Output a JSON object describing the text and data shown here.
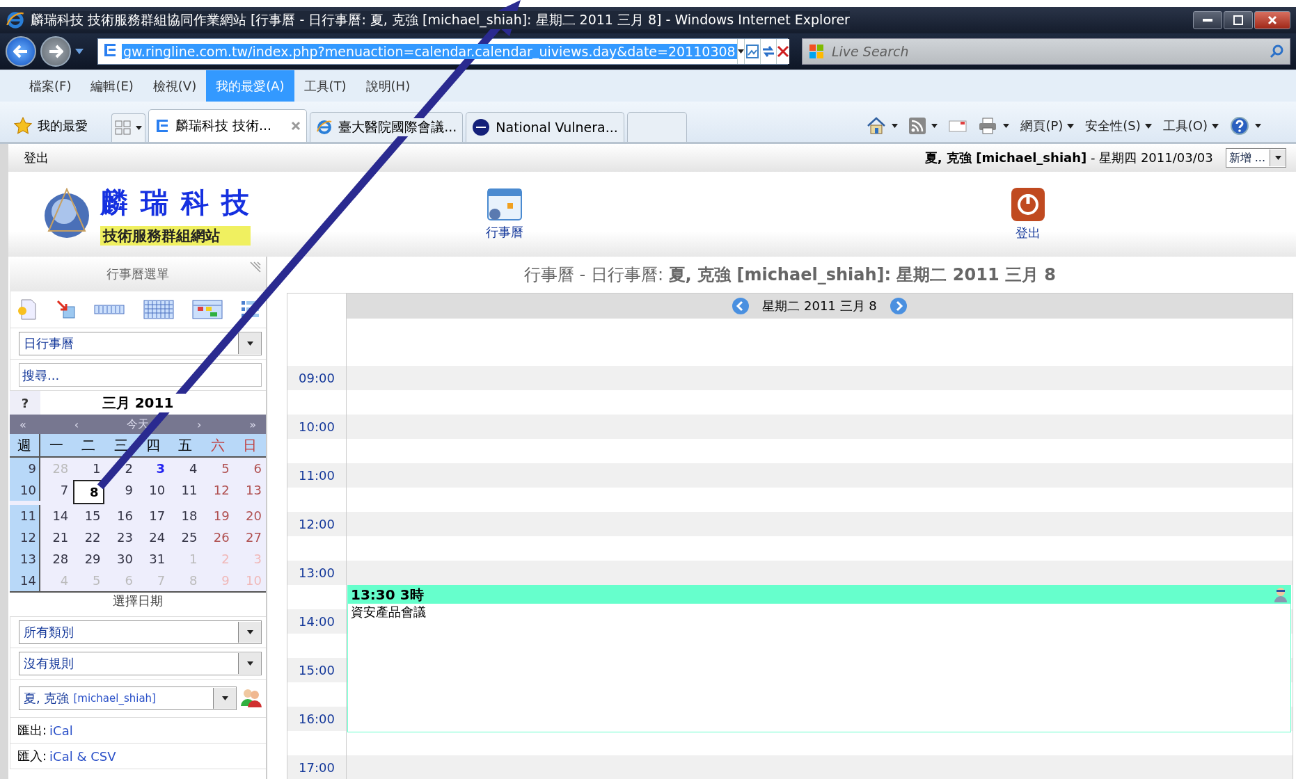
{
  "window": {
    "title": "麟瑞科技 技術服務群組協同作業網站 [行事曆 - 日行事曆: 夏, 克強 [michael_shiah]: 星期二 2011 三月 8] - Windows Internet Explorer"
  },
  "address_bar": {
    "url": "gw.ringline.com.tw/index.php?menuaction=calendar.calendar_uiviews.day&date=20110308"
  },
  "search": {
    "placeholder": "Live Search"
  },
  "menu": [
    {
      "label": "檔案(F)",
      "selected": false
    },
    {
      "label": "編輯(E)",
      "selected": false
    },
    {
      "label": "檢視(V)",
      "selected": false
    },
    {
      "label": "我的最愛(A)",
      "selected": true
    },
    {
      "label": "工具(T)",
      "selected": false
    },
    {
      "label": "說明(H)",
      "selected": false
    }
  ],
  "favorites_button": "我的最愛",
  "tabs": [
    {
      "kind": "site",
      "label": "麟瑞科技 技術...",
      "selected": true
    },
    {
      "kind": "ie",
      "label": "臺大醫院國際會議...",
      "selected": false
    },
    {
      "kind": "nvd",
      "label": "National Vulnera...",
      "selected": false
    },
    {
      "kind": "new",
      "selected": false
    }
  ],
  "command_menus": [
    "網頁(P)",
    "安全性(S)",
    "工具(O)"
  ],
  "page": {
    "logout_link": "登出",
    "user_info": "**夏, 克強 [michael_shiah]** - 星期四 2011/03/03",
    "new_select": "新增 ...",
    "logo_title": "麟 瑞 科 技",
    "logo_subtitle": "技術服務群組網站",
    "apps": [
      {
        "kind": "calendar",
        "label": "行事曆"
      },
      {
        "kind": "logout",
        "label": "登出"
      }
    ]
  },
  "sidebar": {
    "title": "行事曆選單",
    "view_select": "日行事曆",
    "search_placeholder": "搜尋...",
    "mini_calendar": {
      "help": "?",
      "title": "三月 2011",
      "nav": [
        "«",
        "‹",
        "今天",
        "›",
        "»"
      ],
      "weekdays": [
        "週",
        "一",
        "二",
        "三",
        "四",
        "五",
        "六",
        "日"
      ],
      "weeks": [
        {
          "week": "9",
          "days": [
            {
              "d": "28",
              "outside": true,
              "today": false,
              "selected": false
            },
            {
              "d": "1",
              "outside": false,
              "today": false,
              "selected": false
            },
            {
              "d": "2",
              "outside": false,
              "today": false,
              "selected": false
            },
            {
              "d": "3",
              "outside": false,
              "today": true,
              "selected": false
            },
            {
              "d": "4",
              "outside": false,
              "today": false,
              "selected": false
            },
            {
              "d": "5",
              "outside": false,
              "today": false,
              "selected": false
            },
            {
              "d": "6",
              "outside": false,
              "today": false,
              "selected": false
            }
          ]
        },
        {
          "week": "10",
          "days": [
            {
              "d": "7",
              "outside": false,
              "today": false,
              "selected": false
            },
            {
              "d": "8",
              "outside": false,
              "today": false,
              "selected": true
            },
            {
              "d": "9",
              "outside": false,
              "today": false,
              "selected": false
            },
            {
              "d": "10",
              "outside": false,
              "today": false,
              "selected": false
            },
            {
              "d": "11",
              "outside": false,
              "today": false,
              "selected": false
            },
            {
              "d": "12",
              "outside": false,
              "today": false,
              "selected": false
            },
            {
              "d": "13",
              "outside": false,
              "today": false,
              "selected": false
            }
          ]
        },
        {
          "week": "11",
          "days": [
            {
              "d": "14",
              "outside": false,
              "today": false,
              "selected": false
            },
            {
              "d": "15",
              "outside": false,
              "today": false,
              "selected": false
            },
            {
              "d": "16",
              "outside": false,
              "today": false,
              "selected": false
            },
            {
              "d": "17",
              "outside": false,
              "today": false,
              "selected": false
            },
            {
              "d": "18",
              "outside": false,
              "today": false,
              "selected": false
            },
            {
              "d": "19",
              "outside": false,
              "today": false,
              "selected": false
            },
            {
              "d": "20",
              "outside": false,
              "today": false,
              "selected": false
            }
          ]
        },
        {
          "week": "12",
          "days": [
            {
              "d": "21",
              "outside": false,
              "today": false,
              "selected": false
            },
            {
              "d": "22",
              "outside": false,
              "today": false,
              "selected": false
            },
            {
              "d": "23",
              "outside": false,
              "today": false,
              "selected": false
            },
            {
              "d": "24",
              "outside": false,
              "today": false,
              "selected": false
            },
            {
              "d": "25",
              "outside": false,
              "today": false,
              "selected": false
            },
            {
              "d": "26",
              "outside": false,
              "today": false,
              "selected": false
            },
            {
              "d": "27",
              "outside": false,
              "today": false,
              "selected": false
            }
          ]
        },
        {
          "week": "13",
          "days": [
            {
              "d": "28",
              "outside": false,
              "today": false,
              "selected": false
            },
            {
              "d": "29",
              "outside": false,
              "today": false,
              "selected": false
            },
            {
              "d": "30",
              "outside": false,
              "today": false,
              "selected": false
            },
            {
              "d": "31",
              "outside": false,
              "today": false,
              "selected": false
            },
            {
              "d": "1",
              "outside": true,
              "today": false,
              "selected": false
            },
            {
              "d": "2",
              "outside": true,
              "today": false,
              "selected": false
            },
            {
              "d": "3",
              "outside": true,
              "today": false,
              "selected": false
            }
          ]
        },
        {
          "week": "14",
          "days": [
            {
              "d": "4",
              "outside": true,
              "today": false,
              "selected": false
            },
            {
              "d": "5",
              "outside": true,
              "today": false,
              "selected": false
            },
            {
              "d": "6",
              "outside": true,
              "today": false,
              "selected": false
            },
            {
              "d": "7",
              "outside": true,
              "today": false,
              "selected": false
            },
            {
              "d": "8",
              "outside": true,
              "today": false,
              "selected": false
            },
            {
              "d": "9",
              "outside": true,
              "today": false,
              "selected": false
            },
            {
              "d": "10",
              "outside": true,
              "today": false,
              "selected": false
            }
          ]
        }
      ],
      "caption": "選擇日期"
    },
    "category_select": "所有類別",
    "filter_select": "沒有規則",
    "owner_name": "夏, 克強",
    "owner_account": "[michael_shiah]",
    "export": {
      "label": "匯出:",
      "link": "iCal"
    },
    "import": {
      "label": "匯入:",
      "link": "iCal & CSV"
    }
  },
  "main": {
    "title": "行事曆 - 日行事曆: **夏, 克強 [michael_shiah]: 星期二 2011 三月 8**",
    "day_header": "星期二 2011 三月 8",
    "hours": [
      "09:00",
      "10:00",
      "11:00",
      "12:00",
      "13:00",
      "14:00",
      "15:00",
      "16:00",
      "17:00"
    ],
    "event": {
      "start": "13:30",
      "duration": "3時",
      "title": "資安產品會議"
    }
  }
}
